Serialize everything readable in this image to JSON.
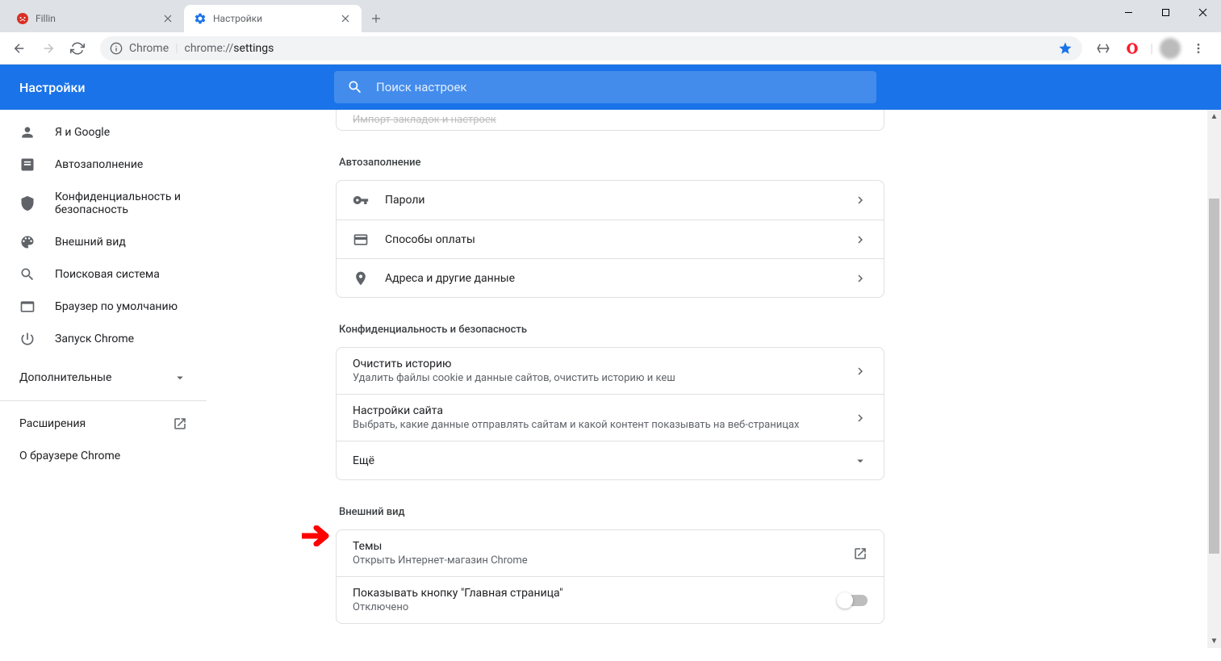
{
  "window": {
    "tabs": [
      {
        "title": "Fillin",
        "active": false
      },
      {
        "title": "Настройки",
        "active": true
      }
    ]
  },
  "toolbar": {
    "omnibox_host": "Chrome",
    "omnibox_url_proto": "chrome://",
    "omnibox_url_path": "settings"
  },
  "header": {
    "title": "Настройки",
    "search_placeholder": "Поиск настроек"
  },
  "sidebar": {
    "items": [
      {
        "label": "Я и Google"
      },
      {
        "label": "Автозаполнение"
      },
      {
        "label": "Конфиденциальность и безопасность"
      },
      {
        "label": "Внешний вид"
      },
      {
        "label": "Поисковая система"
      },
      {
        "label": "Браузер по умолчанию"
      },
      {
        "label": "Запуск Chrome"
      }
    ],
    "advanced": "Дополнительные",
    "extensions": "Расширения",
    "about": "О браузере Chrome"
  },
  "sections": {
    "import_cut": "Импорт закладок и настроек",
    "autofill": {
      "title": "Автозаполнение",
      "items": [
        {
          "label": "Пароли"
        },
        {
          "label": "Способы оплаты"
        },
        {
          "label": "Адреса и другие данные"
        }
      ]
    },
    "privacy": {
      "title": "Конфиденциальность и безопасность",
      "items": [
        {
          "pri": "Очистить историю",
          "sec": "Удалить файлы cookie и данные сайтов, очистить историю и кеш"
        },
        {
          "pri": "Настройки сайта",
          "sec": "Выбрать, какие данные отправлять сайтам и какой контент показывать на веб-страницах"
        },
        {
          "pri": "Ещё"
        }
      ]
    },
    "appearance": {
      "title": "Внешний вид",
      "themes": {
        "pri": "Темы",
        "sec": "Открыть Интернет-магазин Chrome"
      },
      "homebtn": {
        "pri": "Показывать кнопку \"Главная страница\"",
        "sec": "Отключено"
      }
    }
  }
}
